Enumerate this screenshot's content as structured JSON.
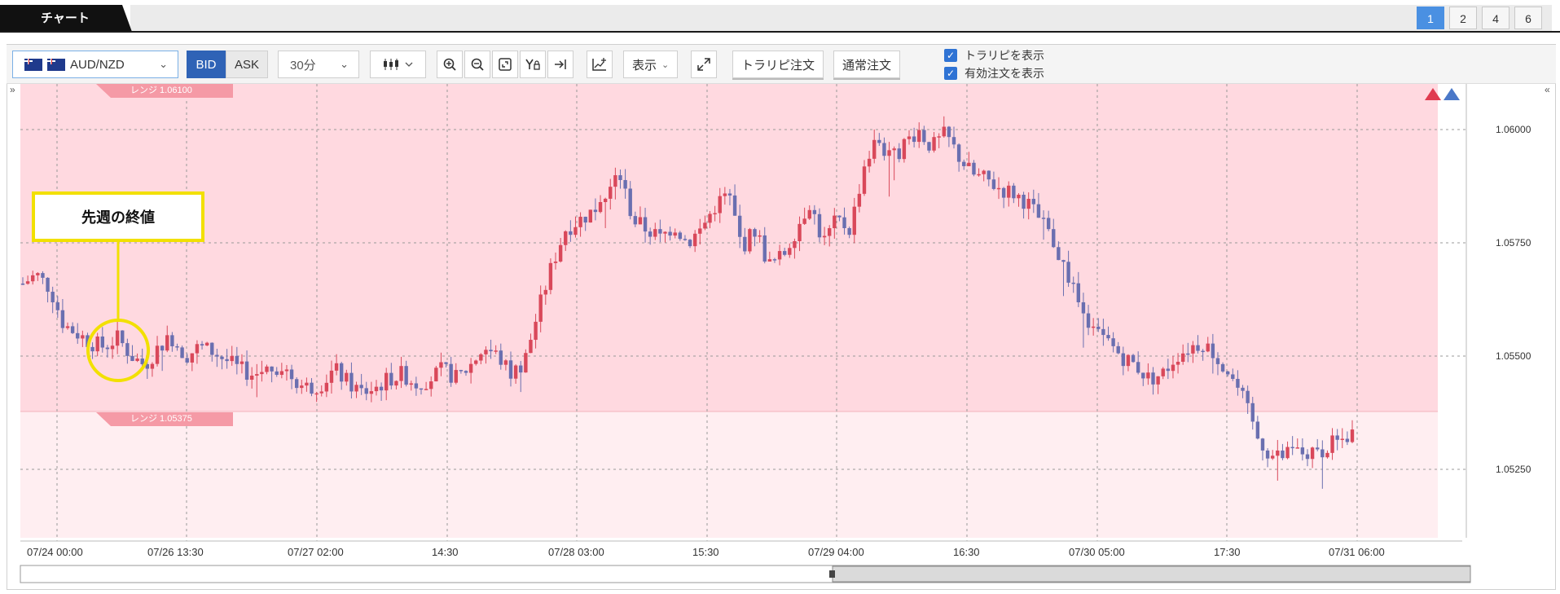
{
  "tabs": {
    "active_label": "チャート",
    "pages": [
      "1",
      "2",
      "4",
      "6"
    ],
    "active_page": "1"
  },
  "toolbar": {
    "symbol": "AUD/NZD",
    "bid_label": "BID",
    "ask_label": "ASK",
    "timeframe": "30分",
    "display_label": "表示",
    "tradelipi_order_label": "トラリピ注文",
    "normal_order_label": "通常注文",
    "show_tradelipi_label": "トラリピを表示",
    "show_active_orders_label": "有効注文を表示"
  },
  "chart": {
    "callout_text": "先週の終値",
    "range_upper_label": "レンジ 1.06100",
    "range_lower_label": "レンジ 1.05375",
    "y_ticks": [
      "1.06000",
      "1.05750",
      "1.05500",
      "1.05250"
    ],
    "x_ticks": [
      "07/24 00:00",
      "07/26 13:30",
      "07/27 02:00",
      "14:30",
      "07/28 03:00",
      "15:30",
      "07/29 04:00",
      "16:30",
      "07/30 05:00",
      "17:30",
      "07/31 06:00"
    ],
    "colors": {
      "up": "#d9485a",
      "down": "#6a6fb0",
      "range_fill": "#ffd9e0",
      "lower_fill": "#ffeef1"
    }
  },
  "chart_data": {
    "type": "candlestick",
    "ylim": [
      1.051,
      1.061
    ],
    "y_ticks": [
      1.06,
      1.0575,
      1.055,
      1.0525
    ],
    "x_ticks": [
      "07/24 00:00",
      "07/26 13:30",
      "07/27 02:00",
      "14:30",
      "07/28 03:00",
      "15:30",
      "07/29 04:00",
      "16:30",
      "07/30 05:00",
      "17:30",
      "07/31 06:00"
    ],
    "range_upper": 1.061,
    "range_lower": 1.05375,
    "close_path": [
      1.0566,
      1.0568,
      1.0565,
      1.0557,
      1.0555,
      1.0553,
      1.0552,
      1.0554,
      1.055,
      1.0548,
      1.0552,
      1.0554,
      1.055,
      1.0552,
      1.0551,
      1.0549,
      1.0547,
      1.0546,
      1.0547,
      1.0548,
      1.0545,
      1.0543,
      1.0544,
      1.0547,
      1.0544,
      1.0542,
      1.0543,
      1.0545,
      1.0546,
      1.0544,
      1.0545,
      1.0547,
      1.0545,
      1.0548,
      1.0552,
      1.055,
      1.0546,
      1.0549,
      1.056,
      1.057,
      1.0578,
      1.058,
      1.0582,
      1.0585,
      1.059,
      1.058,
      1.0578,
      1.0576,
      1.0579,
      1.0575,
      1.0578,
      1.0583,
      1.0586,
      1.0574,
      1.0578,
      1.057,
      1.0572,
      1.0578,
      1.0584,
      1.0575,
      1.058,
      1.0578,
      1.0592,
      1.0598,
      1.0593,
      1.0597,
      1.06,
      1.0596,
      1.0599,
      1.0594,
      1.059,
      1.0589,
      1.0587,
      1.0586,
      1.0584,
      1.058,
      1.0575,
      1.0568,
      1.056,
      1.0555,
      1.0553,
      1.055,
      1.0548,
      1.0545,
      1.0546,
      1.055,
      1.0552,
      1.0553,
      1.055,
      1.0546,
      1.054,
      1.0532,
      1.0528,
      1.0528,
      1.0529,
      1.0528,
      1.053,
      1.0531,
      1.0533
    ]
  }
}
